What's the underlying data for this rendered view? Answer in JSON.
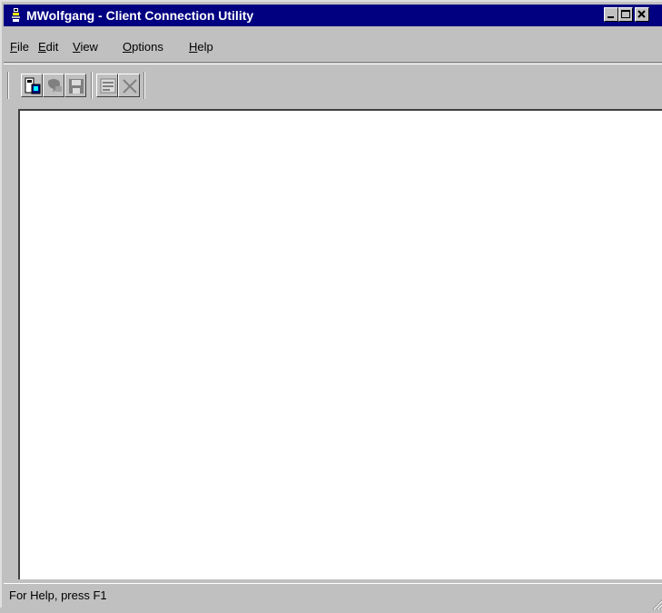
{
  "window": {
    "title": "MWolfgang - Client Connection Utility",
    "title_bar_color": "#000080",
    "icon": "app-icon"
  },
  "caption_buttons": {
    "minimize": "minimize-icon",
    "maximize": "maximize-icon",
    "close": "close-icon"
  },
  "menu": {
    "items": [
      {
        "accel": "F",
        "rest": "ile"
      },
      {
        "accel": "E",
        "rest": "dit"
      },
      {
        "accel": "V",
        "rest": "iew"
      },
      {
        "accel": "O",
        "rest": "ptions"
      },
      {
        "accel": "H",
        "rest": "elp"
      }
    ]
  },
  "toolbar": {
    "buttons": [
      {
        "icon": "connect-icon",
        "enabled": true
      },
      {
        "icon": "disconnect-icon",
        "enabled": false
      },
      {
        "icon": "save-icon",
        "enabled": false
      },
      {
        "icon": "properties-icon",
        "enabled": false
      },
      {
        "icon": "delete-icon",
        "enabled": false
      }
    ]
  },
  "status": {
    "text": "For Help, press F1"
  }
}
